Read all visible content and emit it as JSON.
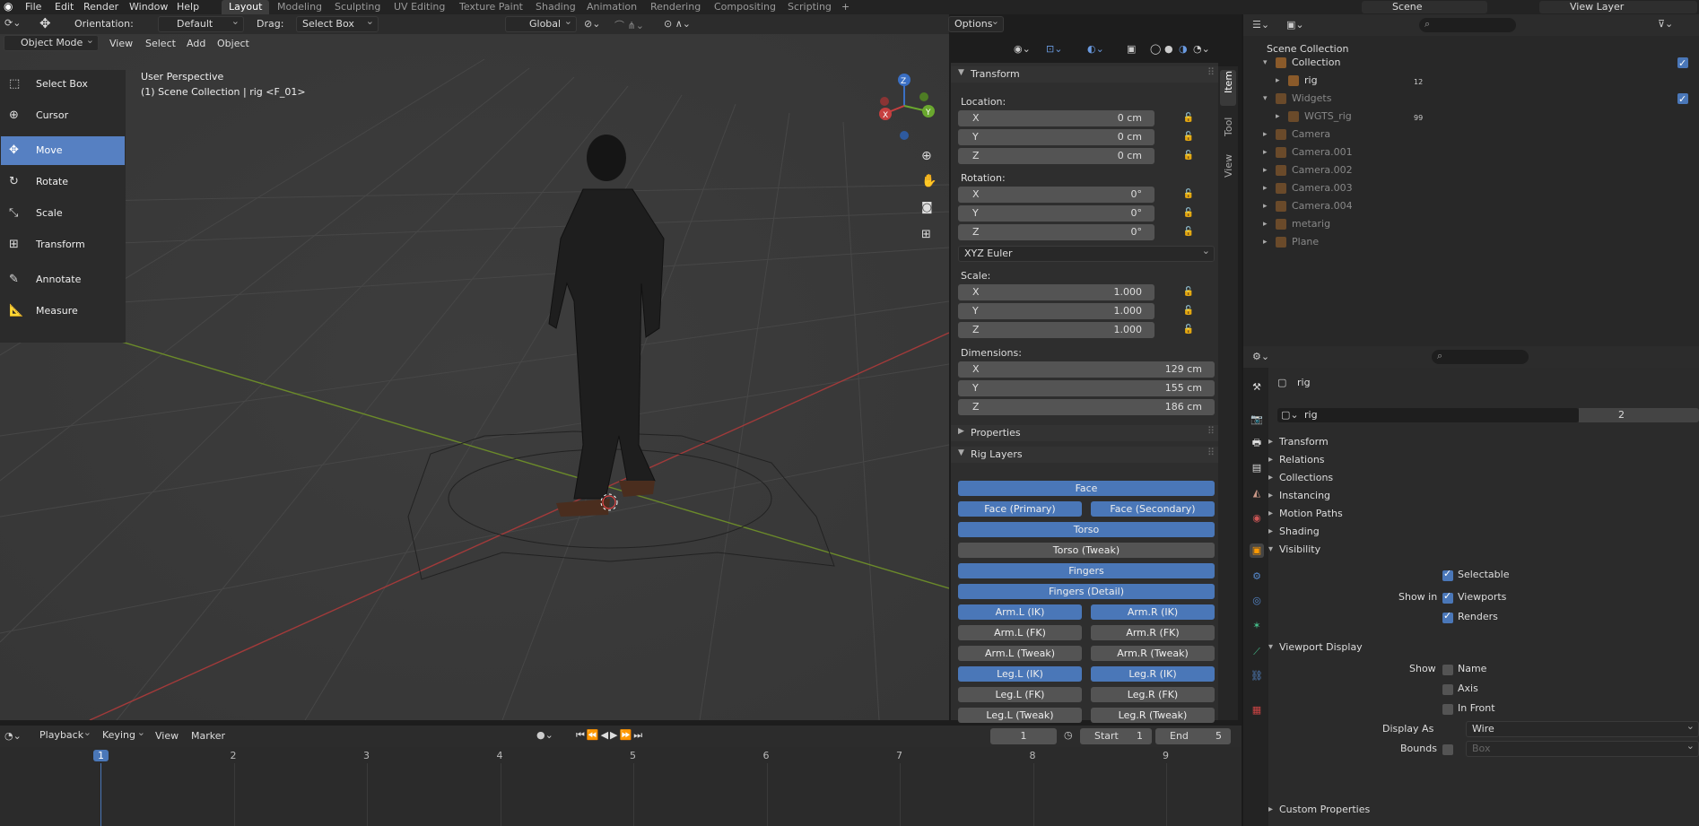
{
  "menubar": {
    "items": [
      "File",
      "Edit",
      "Render",
      "Window",
      "Help"
    ],
    "workspaces": [
      "Layout",
      "Modeling",
      "Sculpting",
      "UV Editing",
      "Texture Paint",
      "Shading",
      "Animation",
      "Rendering",
      "Compositing",
      "Scripting"
    ],
    "scene": "Scene",
    "view_layer": "View Layer"
  },
  "viewport_header": {
    "orientation_label": "Orientation:",
    "orientation_value": "Default",
    "drag_label": "Drag:",
    "drag_value": "Select Box",
    "transform_orientation": "Global",
    "options": "Options",
    "mode": "Object Mode",
    "menus": [
      "View",
      "Select",
      "Add",
      "Object"
    ]
  },
  "viewport": {
    "perspective": "User Perspective",
    "collection_info": "(1) Scene Collection | rig <F_01>",
    "gizmo": {
      "x": "X",
      "y": "Y",
      "z": "Z"
    }
  },
  "toolbar": {
    "tools": [
      "Select Box",
      "Cursor",
      "Move",
      "Rotate",
      "Scale",
      "Transform",
      "Annotate",
      "Measure"
    ],
    "selected": "Move"
  },
  "npanel": {
    "tabs": [
      "Item",
      "Tool",
      "View"
    ],
    "transform_title": "Transform",
    "location_label": "Location:",
    "location": [
      {
        "axis": "X",
        "value": "0 cm"
      },
      {
        "axis": "Y",
        "value": "0 cm"
      },
      {
        "axis": "Z",
        "value": "0 cm"
      }
    ],
    "rotation_label": "Rotation:",
    "rotation": [
      {
        "axis": "X",
        "value": "0°"
      },
      {
        "axis": "Y",
        "value": "0°"
      },
      {
        "axis": "Z",
        "value": "0°"
      }
    ],
    "rotation_mode": "XYZ Euler",
    "scale_label": "Scale:",
    "scale": [
      {
        "axis": "X",
        "value": "1.000"
      },
      {
        "axis": "Y",
        "value": "1.000"
      },
      {
        "axis": "Z",
        "value": "1.000"
      }
    ],
    "dimensions_label": "Dimensions:",
    "dimensions": [
      {
        "axis": "X",
        "value": "129 cm"
      },
      {
        "axis": "Y",
        "value": "155 cm"
      },
      {
        "axis": "Z",
        "value": "186 cm"
      }
    ],
    "properties_title": "Properties",
    "rig_layers_title": "Rig Layers",
    "rig_layers": [
      [
        {
          "label": "Face",
          "on": true
        }
      ],
      [
        {
          "label": "Face (Primary)",
          "on": true
        },
        {
          "label": "Face (Secondary)",
          "on": true
        }
      ],
      [
        {
          "label": "Torso",
          "on": true
        }
      ],
      [
        {
          "label": "Torso (Tweak)",
          "on": false
        }
      ],
      [
        {
          "label": "Fingers",
          "on": true
        }
      ],
      [
        {
          "label": "Fingers (Detail)",
          "on": true
        }
      ],
      [
        {
          "label": "Arm.L (IK)",
          "on": true
        },
        {
          "label": "Arm.R (IK)",
          "on": true
        }
      ],
      [
        {
          "label": "Arm.L (FK)",
          "on": false
        },
        {
          "label": "Arm.R (FK)",
          "on": false
        }
      ],
      [
        {
          "label": "Arm.L (Tweak)",
          "on": false
        },
        {
          "label": "Arm.R (Tweak)",
          "on": false
        }
      ],
      [
        {
          "label": "Leg.L (IK)",
          "on": true
        },
        {
          "label": "Leg.R (IK)",
          "on": true
        }
      ],
      [
        {
          "label": "Leg.L (FK)",
          "on": false
        },
        {
          "label": "Leg.R (FK)",
          "on": false
        }
      ],
      [
        {
          "label": "Leg.L (Tweak)",
          "on": false
        },
        {
          "label": "Leg.R (Tweak)",
          "on": false
        }
      ]
    ]
  },
  "timeline": {
    "menus": [
      "Playback",
      "Keying",
      "View",
      "Marker"
    ],
    "current_frame": "1",
    "start_label": "Start",
    "start": "1",
    "end_label": "End",
    "end": "5",
    "ruler": [
      "1",
      "2",
      "3",
      "4",
      "5",
      "6",
      "7",
      "8",
      "9"
    ]
  },
  "outliner": {
    "root": "Scene Collection",
    "items": [
      {
        "name": "Collection",
        "indent": 1,
        "expand": "▾",
        "dim": false
      },
      {
        "name": "rig",
        "indent": 2,
        "expand": "▸",
        "dim": false,
        "badge": "12"
      },
      {
        "name": "Widgets",
        "indent": 1,
        "expand": "▾",
        "dim": true
      },
      {
        "name": "WGTS_rig",
        "indent": 2,
        "expand": "▸",
        "dim": true,
        "badge": "99"
      },
      {
        "name": "Camera",
        "indent": 1,
        "expand": "▸",
        "dim": true
      },
      {
        "name": "Camera.001",
        "indent": 1,
        "expand": "▸",
        "dim": true
      },
      {
        "name": "Camera.002",
        "indent": 1,
        "expand": "▸",
        "dim": true
      },
      {
        "name": "Camera.003",
        "indent": 1,
        "expand": "▸",
        "dim": true
      },
      {
        "name": "Camera.004",
        "indent": 1,
        "expand": "▸",
        "dim": true
      },
      {
        "name": "metarig",
        "indent": 1,
        "expand": "▸",
        "dim": true
      },
      {
        "name": "Plane",
        "indent": 1,
        "expand": "▸",
        "dim": true
      }
    ]
  },
  "properties": {
    "object_name": "rig",
    "data_name": "rig",
    "users": "2",
    "sections": [
      "Transform",
      "Relations",
      "Collections",
      "Instancing",
      "Motion Paths",
      "Shading"
    ],
    "visibility_title": "Visibility",
    "selectable": "Selectable",
    "show_in_label": "Show in",
    "viewports": "Viewports",
    "renders": "Renders",
    "viewport_display_title": "Viewport Display",
    "show_label": "Show",
    "name_opt": "Name",
    "axis_opt": "Axis",
    "in_front_opt": "In Front",
    "display_as_label": "Display As",
    "display_as_value": "Wire",
    "bounds_label": "Bounds",
    "bounds_value": "Box",
    "custom_properties": "Custom Properties"
  }
}
